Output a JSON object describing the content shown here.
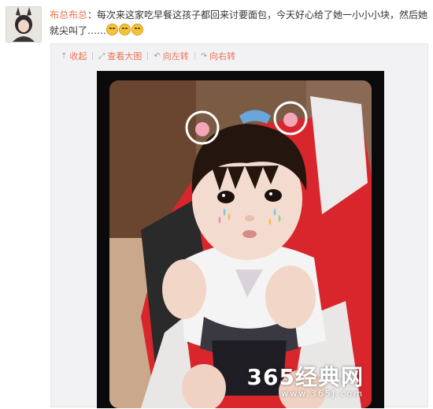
{
  "post": {
    "author": "布总布总",
    "separator": "：",
    "text": "每次来这家吃早餐这孩子都回来讨要面包，今天好心给了她一小小小块，然后她就尖叫了……",
    "emoji_count": 3,
    "emoji_icon": "laugh-cry-emoji-icon"
  },
  "toolbar": {
    "collapse": "收起",
    "view_large": "查看大图",
    "rotate_left": "向左转",
    "rotate_right": "向右转",
    "collapse_icon": "arrow-up-icon",
    "view_large_icon": "magnify-icon",
    "rotate_left_icon": "rotate-left-icon",
    "rotate_right_icon": "rotate-right-icon"
  },
  "watermark": {
    "main": "365经典网",
    "sub": "www.365J.com"
  },
  "colors": {
    "link": "#eb7350",
    "panel_bg": "#f2f2f5",
    "frame": "#0a0a0a"
  }
}
